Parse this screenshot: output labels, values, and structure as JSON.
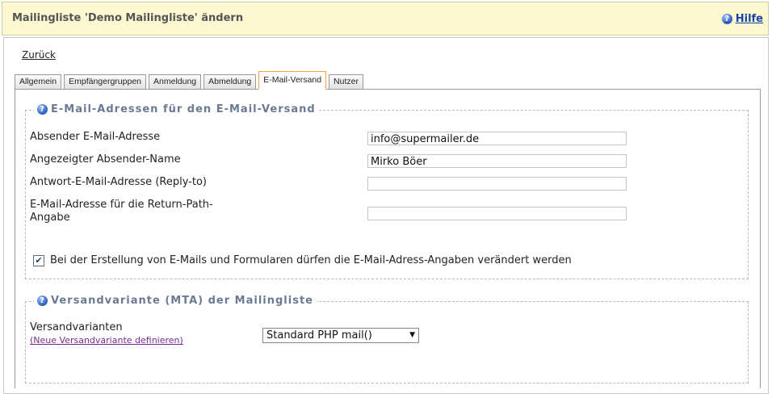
{
  "header": {
    "title": "Mailingliste 'Demo Mailingliste' ändern",
    "help_label": "Hilfe"
  },
  "nav": {
    "back_label": "Zurück"
  },
  "tabs": [
    {
      "label": "Allgemein"
    },
    {
      "label": "Empfängergruppen"
    },
    {
      "label": "Anmeldung"
    },
    {
      "label": "Abmeldung"
    },
    {
      "label": "E-Mail-Versand",
      "active": true
    },
    {
      "label": "Nutzer"
    }
  ],
  "email_section": {
    "legend": "E-Mail-Adressen für den E-Mail-Versand",
    "fields": [
      {
        "label": "Absender E-Mail-Adresse",
        "value": "info@supermailer.de"
      },
      {
        "label": "Angezeigter Absender-Name",
        "value": "Mirko Böer"
      },
      {
        "label": "Antwort-E-Mail-Adresse (Reply-to)",
        "value": ""
      },
      {
        "label_line1": "E-Mail-Adresse für die Return-Path-",
        "label_line2": "Angabe",
        "value": ""
      }
    ],
    "checkbox_label": "Bei der Erstellung von E-Mails und Formularen dürfen die E-Mail-Adress-Angaben verändert werden",
    "checkbox_checked": true
  },
  "mta_section": {
    "legend": "Versandvariante (MTA) der Mailingliste",
    "label": "Versandvarianten",
    "link_label": "(Neue Versandvariante definieren)",
    "selected": "Standard PHP mail()"
  },
  "icons": {
    "help": "question-circle-icon",
    "checkbox": "check-icon",
    "dropdown": "chevron-down-icon"
  }
}
